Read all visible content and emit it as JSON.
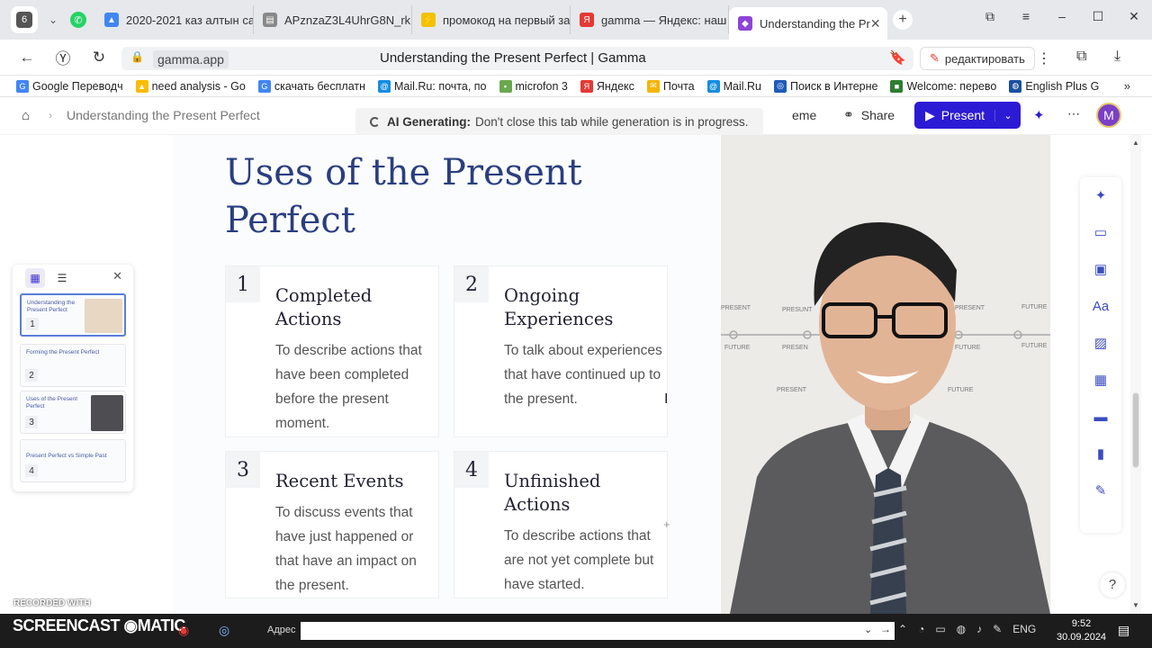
{
  "browser": {
    "tab_count": "6",
    "tabs": [
      {
        "label": "2020-2021 каз алтын са",
        "icon_color": "#4285f4"
      },
      {
        "label": "APznzaZ3L4UhrG8N_rk",
        "icon_color": "#777777"
      },
      {
        "label": "промокод на первый за",
        "icon_color": "#f2c200"
      },
      {
        "label": "gamma — Яндекс: наш",
        "icon_color": "#e53935"
      },
      {
        "label": "Understanding the Pr",
        "icon_color": "#8e44d8",
        "active": true
      }
    ],
    "url_host": "gamma.app",
    "page_title": "Understanding the Present Perfect | Gamma",
    "edit_label": "редактировать",
    "bookmarks": [
      {
        "label": "Google Переводч",
        "color": "#4285f4"
      },
      {
        "label": "need analysis - Go",
        "color": "#fbbc04"
      },
      {
        "label": "скачать бесплатн",
        "color": "#4285f4"
      },
      {
        "label": "Mail.Ru: почта, по",
        "color": "#168de2"
      },
      {
        "label": "microfon 3",
        "color": "#6aa84f"
      },
      {
        "label": "Яндекс",
        "color": "#e53935"
      },
      {
        "label": "Почта",
        "color": "#f4b400"
      },
      {
        "label": "Mail.Ru",
        "color": "#168de2"
      },
      {
        "label": "Поиск в Интерне",
        "color": "#1e5bb8"
      },
      {
        "label": "Welcome: перево",
        "color": "#2e7d32"
      },
      {
        "label": "English Plus G",
        "color": "#1a4fa0"
      }
    ]
  },
  "app": {
    "breadcrumb": "Understanding the Present Perfect",
    "ai_generating_bold": "AI Generating:",
    "ai_generating_text": "Don't close this tab while generation is in progress.",
    "theme_label": "eme",
    "share_label": "Share",
    "present_label": "Present",
    "avatar_initial": "M"
  },
  "slide": {
    "title": "Uses of the Present Perfect",
    "items": [
      {
        "num": "1",
        "heading": "Completed Actions",
        "body": "To describe actions that have been completed before the present moment."
      },
      {
        "num": "2",
        "heading": "Ongoing Experiences",
        "body": "To talk about experiences that have continued up to the present."
      },
      {
        "num": "3",
        "heading": "Recent Events",
        "body": "To discuss events that have just happened or that have an impact on the present."
      },
      {
        "num": "4",
        "heading": "Unfinished Actions",
        "body": "To describe actions that are not yet complete but have started."
      }
    ],
    "photo_labels": [
      "PRESENT",
      "PRESUNT",
      "FUTURE",
      "PRESEN",
      "PRESENT",
      "FUTURE",
      "FUTURE",
      "FUTURE",
      "PRESENT",
      "FUTURE"
    ]
  },
  "thumbnails": [
    {
      "num": "1",
      "title": "Understanding the Present Perfect",
      "selected": true
    },
    {
      "num": "2",
      "title": "Forming the Present Perfect"
    },
    {
      "num": "3",
      "title": "Uses of the Present Perfect"
    },
    {
      "num": "4",
      "title": "Present Perfect vs Simple Past"
    }
  ],
  "watermark": {
    "line1": "RECORDED WITH",
    "line2": "SCREENCAST",
    "line3": "MATIC"
  },
  "taskbar": {
    "address_label": "Адрес",
    "lang": "ENG",
    "time": "9:52",
    "date": "30.09.2024"
  }
}
